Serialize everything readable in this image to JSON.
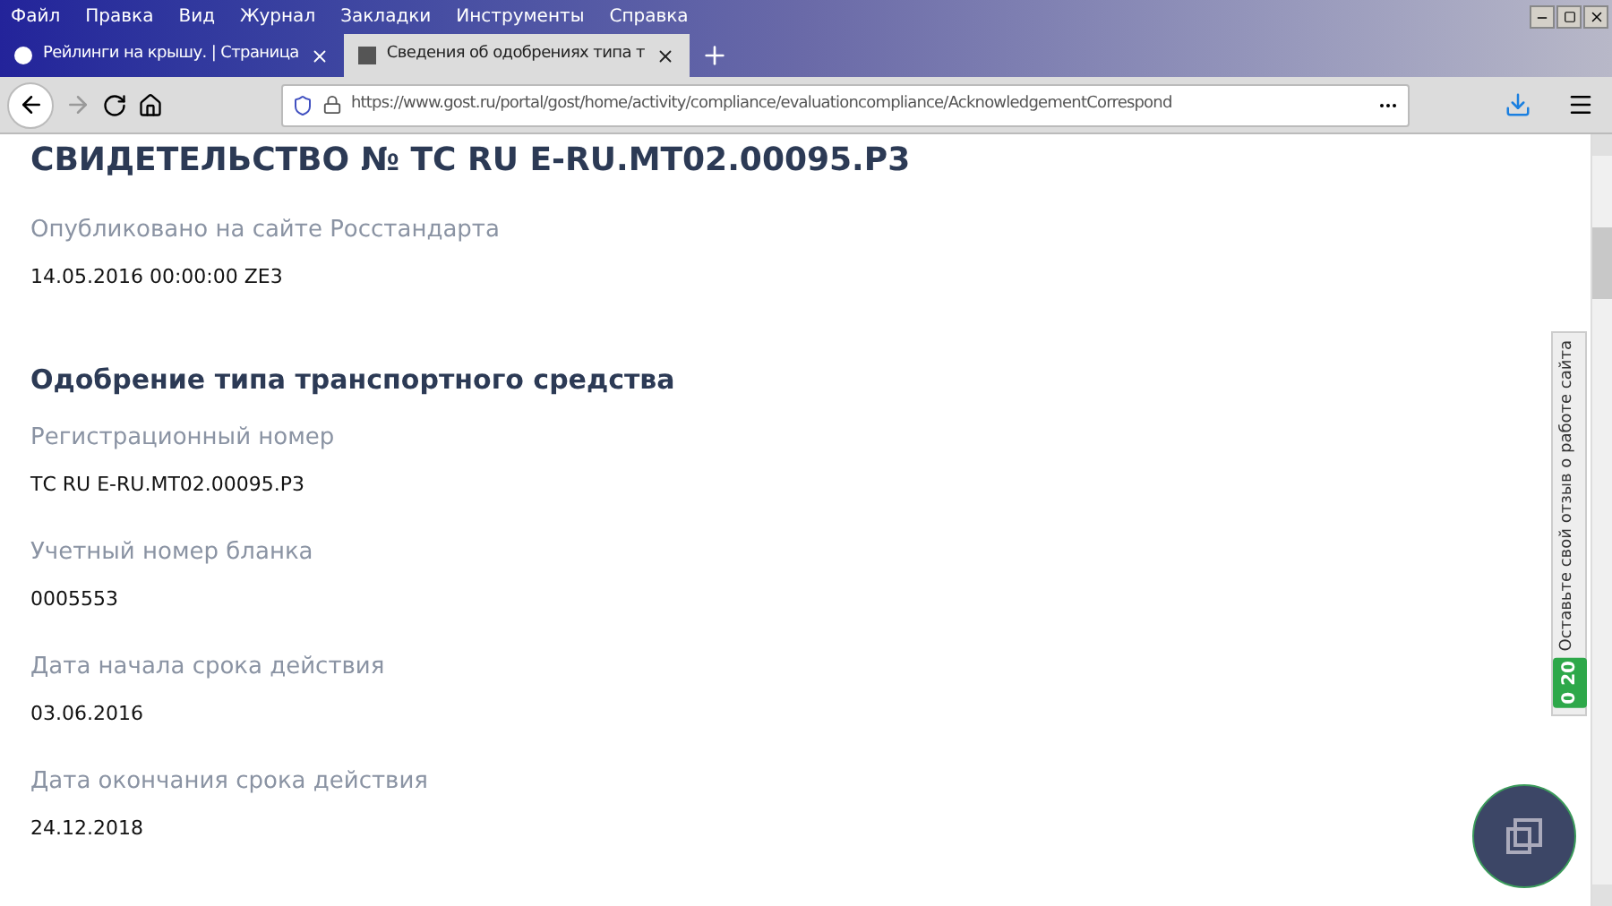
{
  "menu": [
    "Файл",
    "Правка",
    "Вид",
    "Журнал",
    "Закладки",
    "Инструменты",
    "Справка"
  ],
  "tabs": [
    {
      "label": "Рейлинги на крышу. | Страница",
      "selected": false
    },
    {
      "label": "Сведения об одобрениях типа т",
      "selected": true
    }
  ],
  "address": "https://www.gost.ru/portal/gost/home/activity/compliance/evaluationcompliance/AcknowledgementCorrespond",
  "heading": "СВИДЕТЕЛЬСТВО № ТС RU E-RU.MT02.00095.Р3",
  "fields_top": [
    {
      "label": "Опубликовано на сайте Росстандарта",
      "value": "14.05.2016 00:00:00 ZE3"
    }
  ],
  "section": "Одобрение типа транспортного средства",
  "fields": [
    {
      "label": "Регистрационный номер",
      "value": "ТС RU E-RU.MT02.00095.Р3"
    },
    {
      "label": "Учетный номер бланка",
      "value": "0005553"
    },
    {
      "label": "Дата начала срока действия",
      "value": "03.06.2016"
    },
    {
      "label": "Дата окончания срока действия",
      "value": "24.12.2018"
    }
  ],
  "feedback": {
    "label": "Оставьте свой отзыв о работе сайта",
    "count": "0 20"
  }
}
